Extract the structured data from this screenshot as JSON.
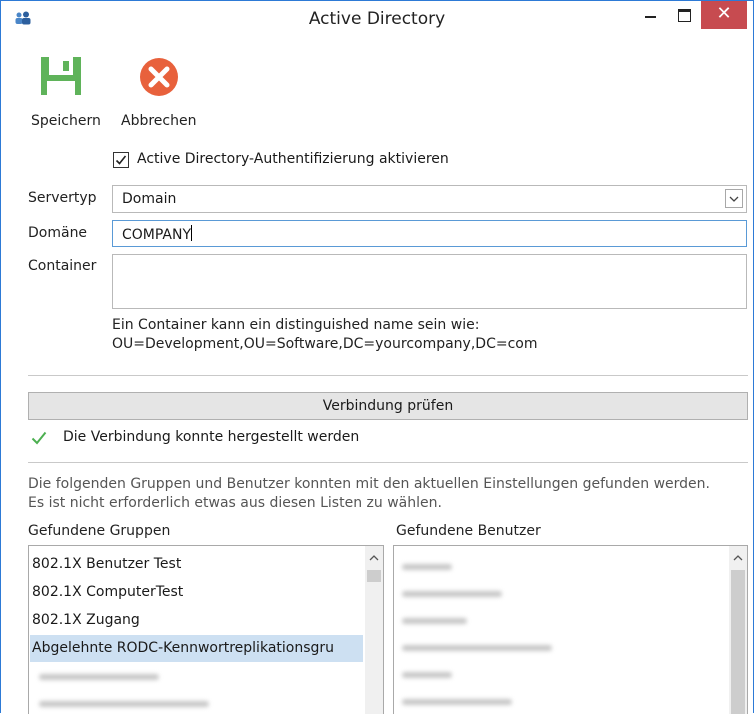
{
  "window": {
    "title": "Active Directory",
    "close_glyph": "✕",
    "icons": {
      "app": "users-icon",
      "minimize": "minimize-icon",
      "maximize": "maximize-icon",
      "close": "close-icon"
    }
  },
  "toolbar": {
    "save_label": "Speichern",
    "cancel_label": "Abbrechen",
    "save_color": "#5fb35a",
    "cancel_color": "#e8613c"
  },
  "form": {
    "enable_ad_label": "Active Directory-Authentifizierung aktivieren",
    "enable_ad_checked": true,
    "server_type_label": "Servertyp",
    "server_type_value": "Domain",
    "domain_label": "Domäne",
    "domain_value": "COMPANY",
    "container_label": "Container",
    "container_value": "",
    "container_hint_line1": "Ein Container kann ein distinguished name sein wie:",
    "container_hint_line2": "OU=Development,OU=Software,DC=yourcompany,DC=com"
  },
  "verify": {
    "button_label": "Verbindung prüfen",
    "status_text": "Die Verbindung konnte hergestellt werden",
    "status_color": "#4caf50"
  },
  "results": {
    "info_line1": "Die folgenden Gruppen und Benutzer konnten mit den aktuellen Einstellungen gefunden werden.",
    "info_line2": "Es ist nicht erforderlich etwas aus diesen Listen zu wählen.",
    "groups_title": "Gefundene Gruppen",
    "users_title": "Gefundene Benutzer",
    "groups": [
      "802.1X Benutzer Test",
      "802.1X ComputerTest",
      "802.1X Zugang",
      "Abgelehnte RODC-Kennwortreplikationsgru"
    ],
    "selected_group_index": 3
  }
}
